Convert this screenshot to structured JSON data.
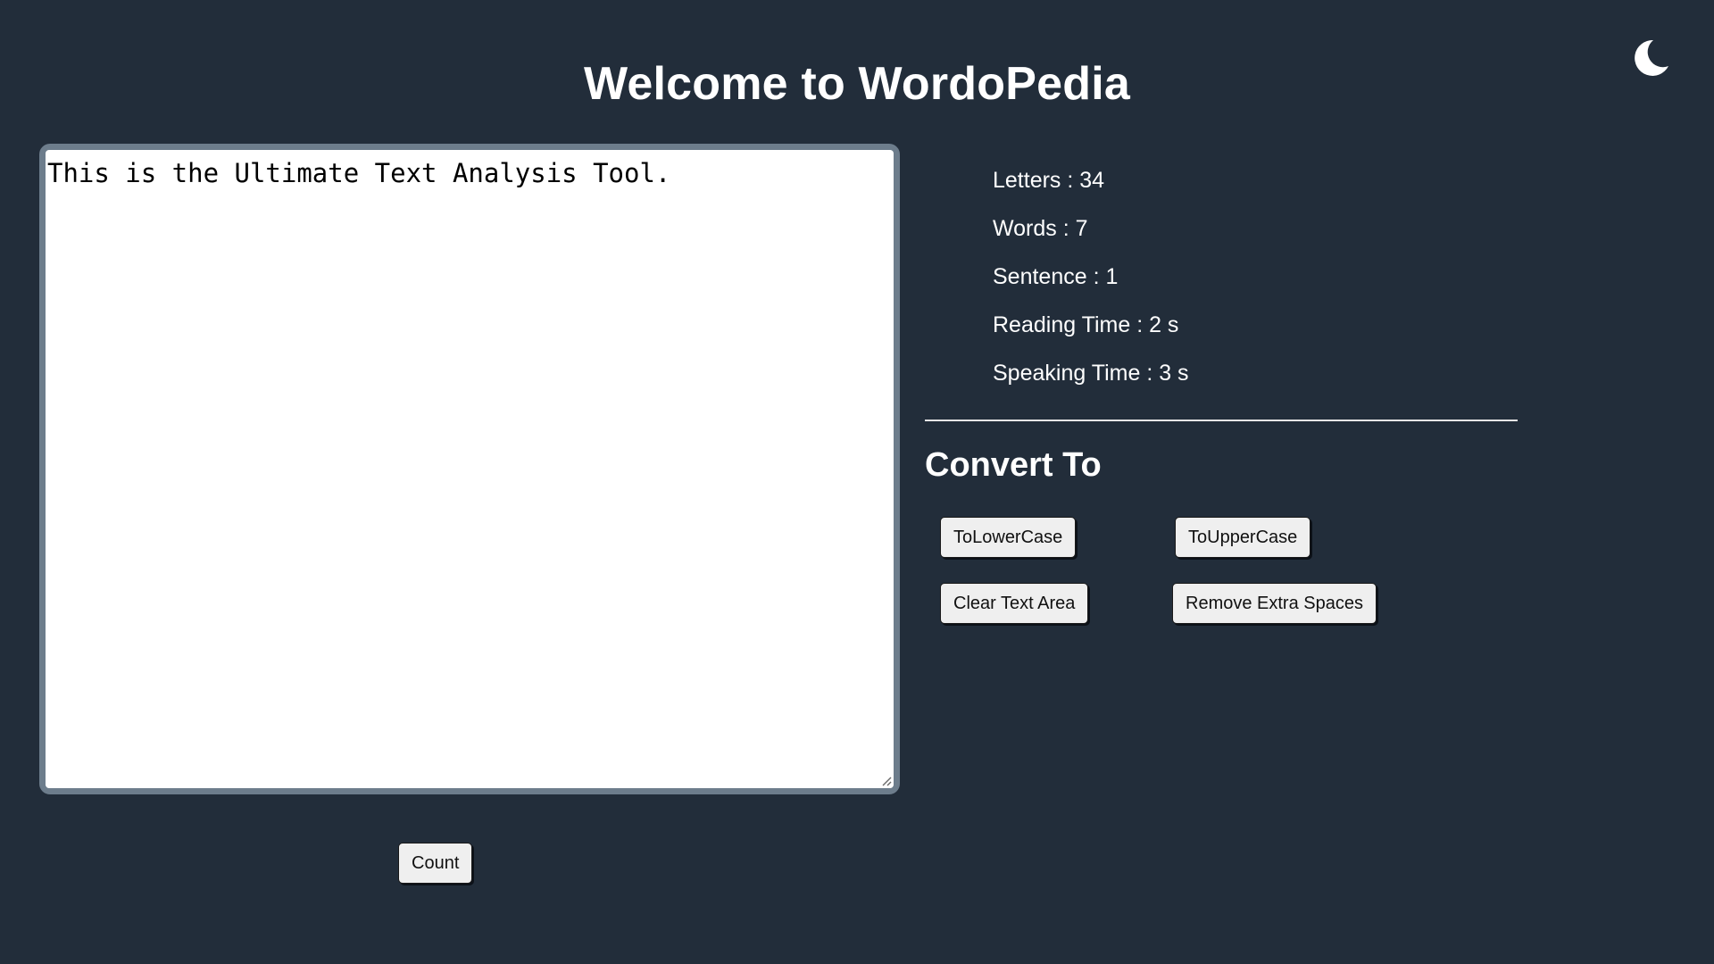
{
  "header": {
    "title": "Welcome to WordoPedia"
  },
  "theme_toggle": {
    "icon": "moon-icon"
  },
  "editor": {
    "value": "This is the Ultimate Text Analysis Tool.",
    "count_label": "Count"
  },
  "stats": [
    {
      "label": "Letters",
      "value": "34",
      "text": "Letters : 34"
    },
    {
      "label": "Words",
      "value": "7",
      "text": "Words : 7"
    },
    {
      "label": "Sentence",
      "value": "1",
      "text": "Sentence : 1"
    },
    {
      "label": "Reading Time",
      "value": "2 s",
      "text": "Reading Time : 2 s"
    },
    {
      "label": "Speaking Time",
      "value": "3 s",
      "text": "Speaking Time : 3 s"
    }
  ],
  "convert": {
    "heading": "Convert To",
    "buttons": {
      "lowercase": "ToLowerCase",
      "uppercase": "ToUpperCase",
      "clear": "Clear Text Area",
      "remove_spaces": "Remove Extra Spaces"
    }
  },
  "colors": {
    "background": "#222d3a",
    "text": "#ffffff",
    "textarea_border": "#6d7d8c",
    "button_bg": "#efefef"
  }
}
